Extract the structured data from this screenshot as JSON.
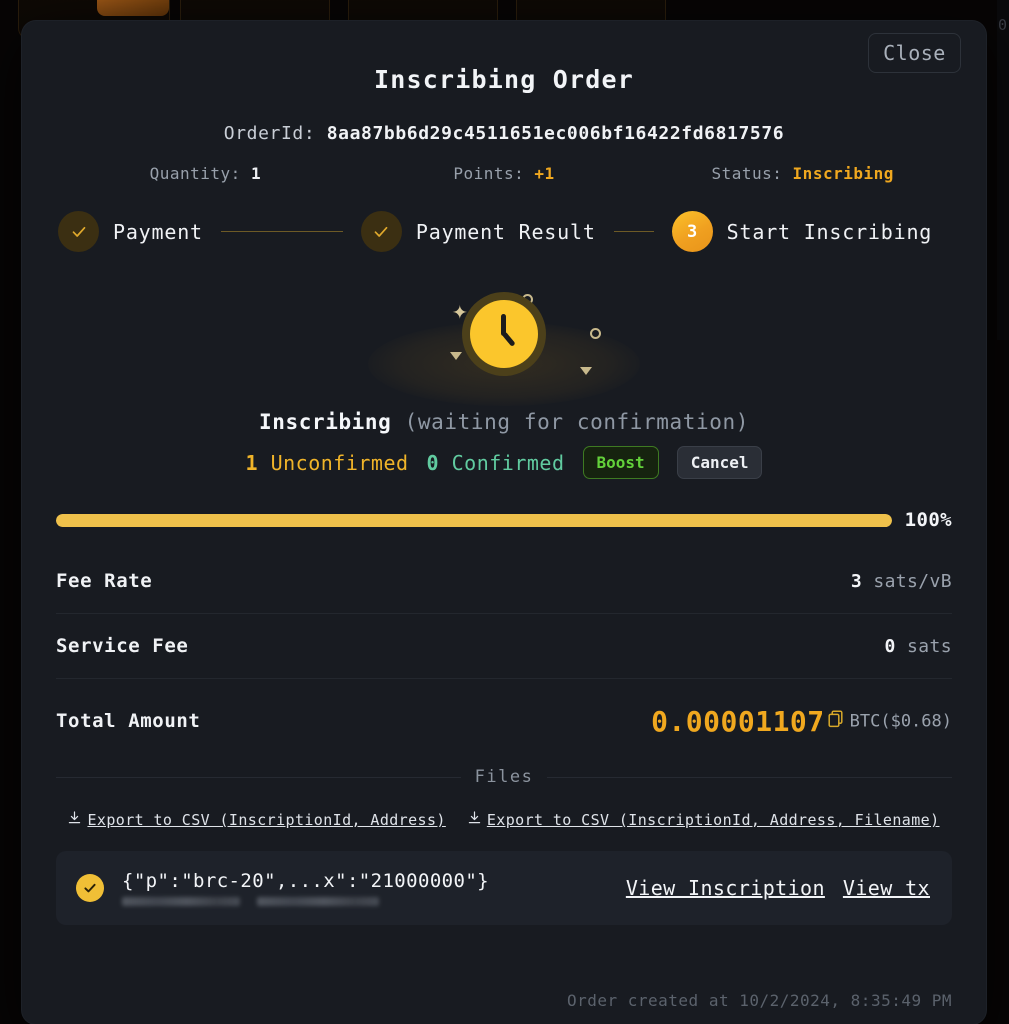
{
  "background": {
    "right_edge_glyph": "0"
  },
  "modal": {
    "close_label": "Close",
    "title": "Inscribing Order",
    "order_id_label": "OrderId:",
    "order_id_value": "8aa87bb6d29c4511651ec006bf16422fd6817576",
    "meta": [
      {
        "label": "Quantity:",
        "value": "1",
        "accent": false
      },
      {
        "label": "Points:",
        "value": "+1",
        "accent": true
      },
      {
        "label": "Status:",
        "value": "Inscribing",
        "accent": true
      }
    ],
    "steps": [
      {
        "label": "Payment",
        "state": "done",
        "marker": "check"
      },
      {
        "label": "Payment Result",
        "state": "done",
        "marker": "check"
      },
      {
        "label": "Start Inscribing",
        "state": "active",
        "marker": "3"
      }
    ],
    "illustration": {
      "icon": "clock-icon"
    },
    "status": {
      "main": "Inscribing",
      "note": "(waiting for confirmation)",
      "unconfirmed_count": "1",
      "unconfirmed_label": "Unconfirmed",
      "confirmed_count": "0",
      "confirmed_label": "Confirmed",
      "boost_label": "Boost",
      "cancel_label": "Cancel"
    },
    "progress": {
      "percent_label": "100%",
      "percent_value": 100
    },
    "fees": [
      {
        "key": "Fee Rate",
        "value": "3",
        "unit": "sats/vB"
      },
      {
        "key": "Service Fee",
        "value": "0",
        "unit": "sats"
      }
    ],
    "total": {
      "key": "Total Amount",
      "amount": "0.00001107",
      "unit": "BTC($0.68)"
    },
    "files_section": {
      "heading": "Files",
      "export_links": [
        "Export to CSV (InscriptionId, Address)",
        "Export to CSV (InscriptionId, Address, Filename)"
      ],
      "items": [
        {
          "title": "{\"p\":\"brc-20\",...x\":\"21000000\"}",
          "view_inscription_label": "View Inscription",
          "view_tx_label": "View tx"
        }
      ]
    },
    "created_at": "Order created at 10/2/2024, 8:35:49 PM"
  },
  "colors": {
    "accent_amber": "#f0a81f",
    "accent_yellow": "#fbc62c",
    "confirmed_green": "#61cba0",
    "boost_green": "#63d13a",
    "modal_bg": "#181b21",
    "card_bg": "#1e222a"
  }
}
